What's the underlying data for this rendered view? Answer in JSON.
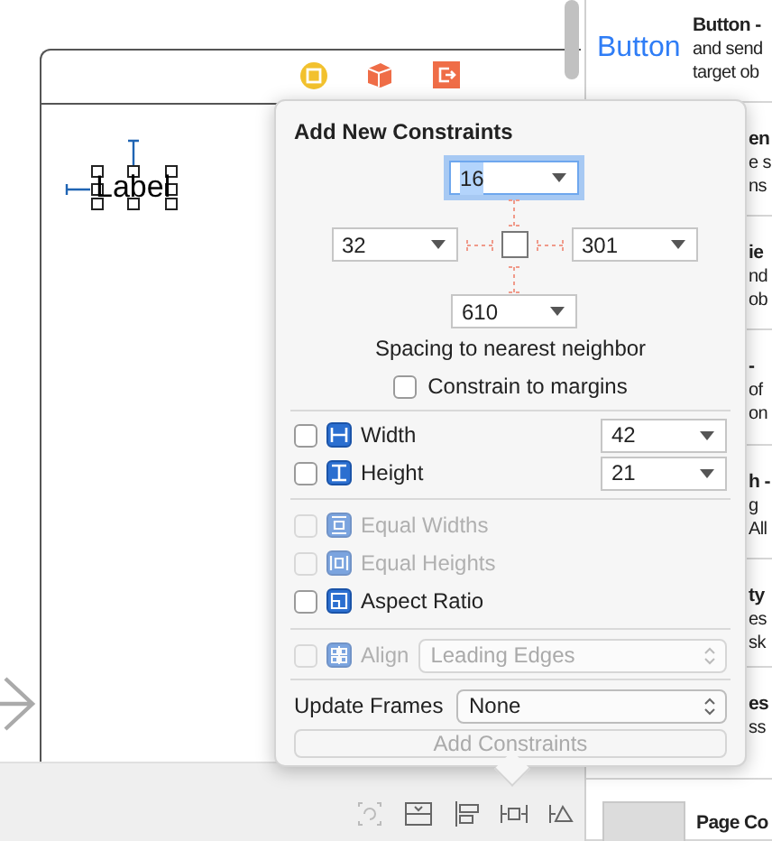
{
  "scene": {
    "label": "Label"
  },
  "popover": {
    "title": "Add New Constraints",
    "spacing": {
      "top": {
        "value": "16",
        "focused": true
      },
      "left": {
        "value": "32",
        "focused": false
      },
      "right": {
        "value": "301",
        "focused": false
      },
      "bottom": {
        "value": "610",
        "focused": false
      }
    },
    "spacing_caption": "Spacing to nearest neighbor",
    "constrain_to_margins": {
      "label": "Constrain to margins",
      "checked": false
    },
    "constraints": [
      {
        "label": "Width",
        "checked": false,
        "disabled": false,
        "value": "42"
      },
      {
        "label": "Height",
        "checked": false,
        "disabled": false,
        "value": "21"
      },
      {
        "label": "Equal Widths",
        "checked": false,
        "disabled": true
      },
      {
        "label": "Equal Heights",
        "checked": false,
        "disabled": true
      },
      {
        "label": "Aspect Ratio",
        "checked": false,
        "disabled": false
      }
    ],
    "align": {
      "label": "Align",
      "checked": false,
      "disabled": true,
      "value": "Leading Edges"
    },
    "update_frames": {
      "label": "Update Frames",
      "value": "None"
    },
    "add_button": {
      "label": "Add Constraints",
      "disabled": true
    }
  },
  "library": [
    {
      "preview": "Button",
      "lines": [
        "Button -",
        "and send",
        "target ob"
      ]
    },
    {
      "lines": [
        "en",
        "e s",
        "ns"
      ]
    },
    {
      "lines": [
        "ie",
        "nd",
        "ob"
      ]
    },
    {
      "lines": [
        "-",
        "of",
        "on"
      ]
    },
    {
      "lines": [
        "h -",
        "g",
        "All"
      ]
    },
    {
      "lines": [
        "ty",
        "es",
        "sk"
      ]
    },
    {
      "lines": [
        "es",
        "ss"
      ]
    },
    {
      "lines": [
        "Page Co"
      ]
    }
  ]
}
